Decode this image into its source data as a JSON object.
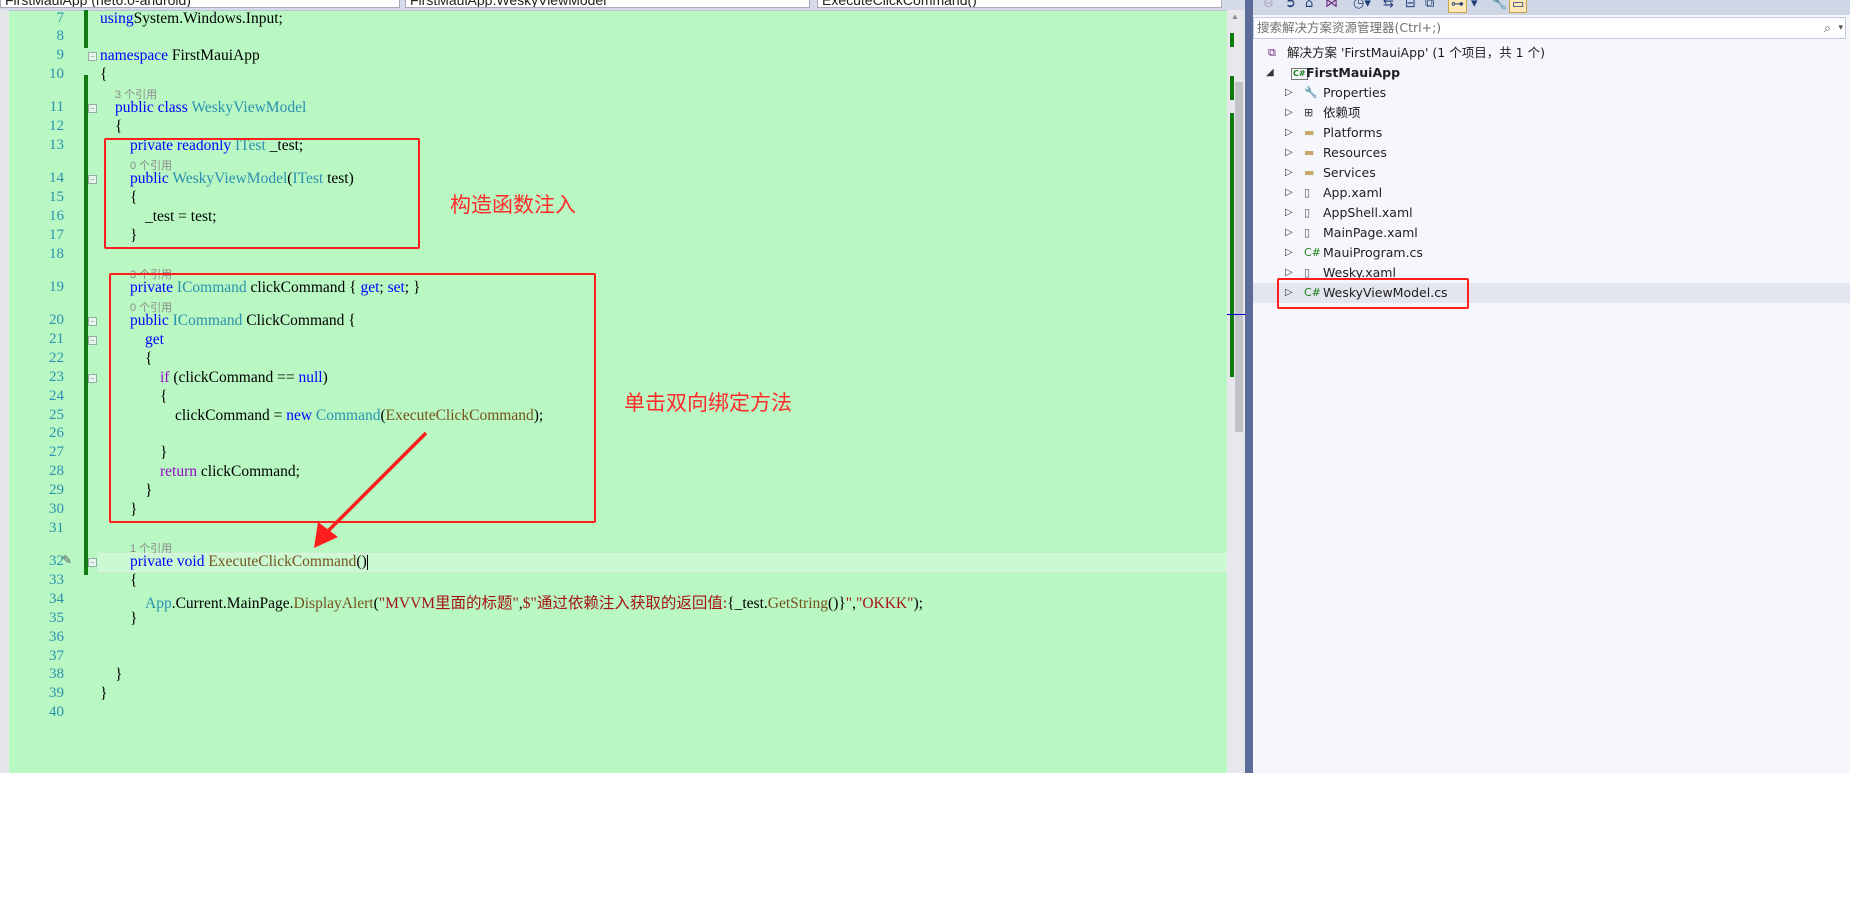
{
  "navbar": {
    "project_combo": "FirstMauiApp (net6.0-android)",
    "class_combo": "FirstMauiApp.WeskyViewModel",
    "member_combo": "ExecuteClickCommand()"
  },
  "editor": {
    "rows": [
      {
        "n": "7",
        "i": 0,
        "t": [
          [
            "kw",
            "using"
          ],
          [
            "",
            "System.Windows.Input;"
          ]
        ]
      },
      {
        "n": "8",
        "i": 0,
        "t": []
      },
      {
        "n": "9",
        "i": 0,
        "fold": true,
        "t": [
          [
            "kw",
            "namespace"
          ],
          [
            "",
            " FirstMauiApp"
          ]
        ]
      },
      {
        "n": "10",
        "i": 0,
        "t": [
          [
            "",
            "{"
          ]
        ]
      },
      {
        "lens": "3 个引用",
        "i": 1
      },
      {
        "n": "11",
        "i": 1,
        "fold": true,
        "t": [
          [
            "kw",
            "public class "
          ],
          [
            "ty",
            "WeskyViewModel"
          ]
        ]
      },
      {
        "n": "12",
        "i": 1,
        "t": [
          [
            "",
            "{"
          ]
        ]
      },
      {
        "n": "13",
        "i": 2,
        "t": [
          [
            "kw",
            "private readonly "
          ],
          [
            "ty",
            "ITest"
          ],
          [
            "",
            " _test;"
          ]
        ]
      },
      {
        "lens": "0 个引用",
        "i": 2
      },
      {
        "n": "14",
        "i": 2,
        "fold": true,
        "t": [
          [
            "kw",
            "public "
          ],
          [
            "ty",
            "WeskyViewModel"
          ],
          [
            "",
            "("
          ],
          [
            "ty",
            "ITest"
          ],
          [
            "",
            " test)"
          ]
        ]
      },
      {
        "n": "15",
        "i": 2,
        "t": [
          [
            "",
            "{"
          ]
        ]
      },
      {
        "n": "16",
        "i": 3,
        "t": [
          [
            "",
            "_test = test;"
          ]
        ]
      },
      {
        "n": "17",
        "i": 2,
        "t": [
          [
            "",
            "}"
          ]
        ]
      },
      {
        "n": "18",
        "i": 0,
        "t": []
      },
      {
        "lens": "3 个引用",
        "i": 2
      },
      {
        "n": "19",
        "i": 2,
        "t": [
          [
            "kw",
            "private "
          ],
          [
            "ty",
            "ICommand"
          ],
          [
            "",
            " clickCommand { "
          ],
          [
            "kw",
            "get"
          ],
          [
            "",
            "; "
          ],
          [
            "kw",
            "set"
          ],
          [
            "",
            "; }"
          ]
        ]
      },
      {
        "lens": "0 个引用",
        "i": 2
      },
      {
        "n": "20",
        "i": 2,
        "fold": true,
        "t": [
          [
            "kw",
            "public "
          ],
          [
            "ty",
            "ICommand"
          ],
          [
            "",
            " ClickCommand {"
          ]
        ]
      },
      {
        "n": "21",
        "i": 3,
        "fold": true,
        "t": [
          [
            "kw",
            "get"
          ]
        ]
      },
      {
        "n": "22",
        "i": 3,
        "t": [
          [
            "",
            "{"
          ]
        ]
      },
      {
        "n": "23",
        "i": 4,
        "fold": true,
        "t": [
          [
            "cf",
            "if"
          ],
          [
            "",
            " (clickCommand == "
          ],
          [
            "kw",
            "null"
          ],
          [
            "",
            ")"
          ]
        ]
      },
      {
        "n": "24",
        "i": 4,
        "t": [
          [
            "",
            "{"
          ]
        ]
      },
      {
        "n": "25",
        "i": 5,
        "t": [
          [
            "",
            "clickCommand = "
          ],
          [
            "kw",
            "new "
          ],
          [
            "ty",
            "Command"
          ],
          [
            "",
            "("
          ],
          [
            "me",
            "ExecuteClickCommand"
          ],
          [
            "",
            ");"
          ]
        ]
      },
      {
        "n": "26",
        "i": 0,
        "t": []
      },
      {
        "n": "27",
        "i": 4,
        "t": [
          [
            "",
            "}"
          ]
        ]
      },
      {
        "n": "28",
        "i": 4,
        "t": [
          [
            "cf",
            "return"
          ],
          [
            "",
            " clickCommand;"
          ]
        ]
      },
      {
        "n": "29",
        "i": 3,
        "t": [
          [
            "",
            "}"
          ]
        ]
      },
      {
        "n": "30",
        "i": 2,
        "t": [
          [
            "",
            "}"
          ]
        ]
      },
      {
        "n": "31",
        "i": 0,
        "t": []
      },
      {
        "lens": "1 个引用",
        "i": 2
      },
      {
        "n": "32",
        "i": 2,
        "fold": true,
        "cur": true,
        "t": [
          [
            "kw",
            "private void "
          ],
          [
            "me",
            "ExecuteClickCommand"
          ],
          [
            "",
            "()"
          ]
        ]
      },
      {
        "n": "33",
        "i": 2,
        "t": [
          [
            "",
            "{"
          ]
        ]
      },
      {
        "n": "34",
        "i": 3,
        "t": [
          [
            "ty",
            "App"
          ],
          [
            "",
            ".Current.MainPage."
          ],
          [
            "me",
            "DisplayAlert"
          ],
          [
            "",
            "("
          ],
          [
            "st",
            "\"MVVM里面的标题\""
          ],
          [
            "",
            ","
          ],
          [
            "st",
            "$\"通过依赖注入获取的返回值:"
          ],
          [
            "",
            "{_test."
          ],
          [
            "me",
            "GetString"
          ],
          [
            "",
            "()}"
          ],
          [
            "st",
            "\""
          ],
          [
            "",
            ","
          ],
          [
            "st",
            "\"OKKK\""
          ],
          [
            "",
            ");"
          ]
        ]
      },
      {
        "n": "35",
        "i": 2,
        "t": [
          [
            "",
            "}"
          ]
        ]
      },
      {
        "n": "36",
        "i": 0,
        "t": []
      },
      {
        "n": "37",
        "i": 0,
        "t": []
      },
      {
        "n": "38",
        "i": 1,
        "t": [
          [
            "",
            "}"
          ]
        ]
      },
      {
        "n": "39",
        "i": 0,
        "t": [
          [
            "",
            "}"
          ]
        ]
      },
      {
        "n": "40",
        "i": 0,
        "t": []
      }
    ]
  },
  "annotations": {
    "constructor_note": "构造函数注入",
    "command_note": "单击双向绑定方法",
    "color": "#ff1e1e"
  },
  "solution_explorer": {
    "search_placeholder": "搜索解决方案资源管理器(Ctrl+;)",
    "solution_label": "解决方案 'FirstMauiApp' (1 个项目，共 1 个)",
    "project_label": "FirstMauiApp",
    "items": [
      {
        "label": "Properties",
        "icon": "properties-icon"
      },
      {
        "label": "依赖项",
        "icon": "dependencies-icon"
      },
      {
        "label": "Platforms",
        "icon": "folder-icon"
      },
      {
        "label": "Resources",
        "icon": "folder-icon"
      },
      {
        "label": "Services",
        "icon": "folder-icon"
      },
      {
        "label": "App.xaml",
        "icon": "xaml-file-icon"
      },
      {
        "label": "AppShell.xaml",
        "icon": "xaml-file-icon"
      },
      {
        "label": "MainPage.xaml",
        "icon": "xaml-file-icon"
      },
      {
        "label": "MauiProgram.cs",
        "icon": "csharp-file-icon"
      },
      {
        "label": "Wesky.xaml",
        "icon": "xaml-file-icon"
      },
      {
        "label": "WeskyViewModel.cs",
        "icon": "csharp-file-icon",
        "selected": true
      }
    ]
  }
}
